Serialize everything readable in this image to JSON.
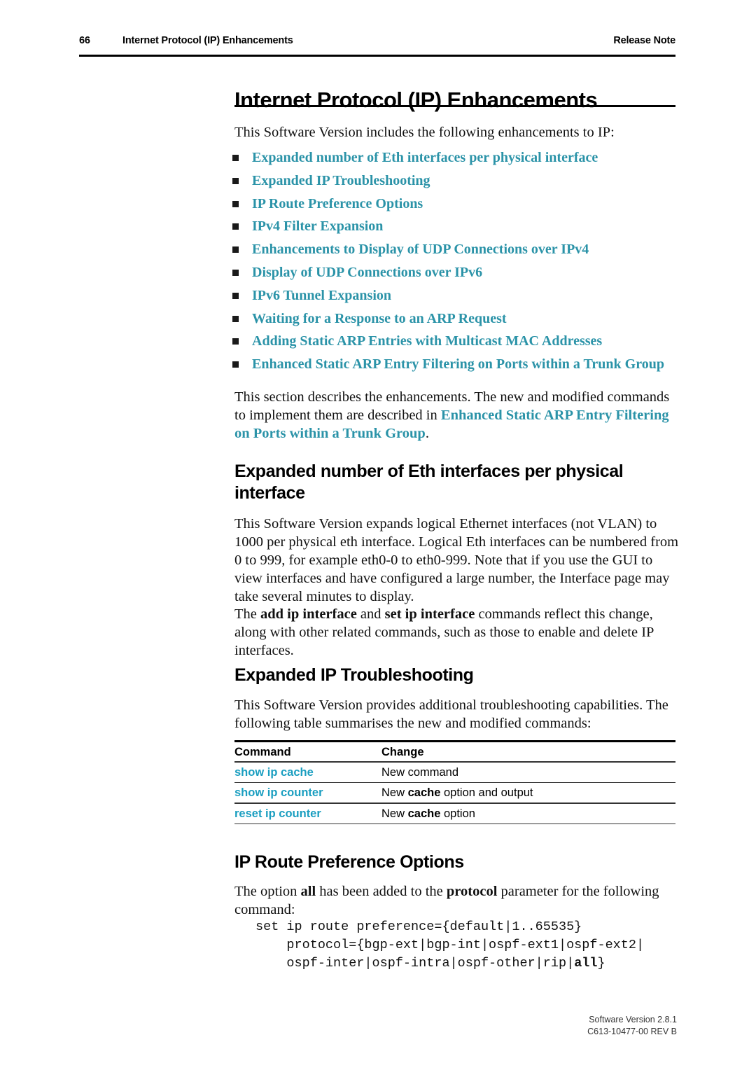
{
  "header": {
    "page_number": "66",
    "section_title": "Internet Protocol (IP) Enhancements",
    "document_type": "Release Note"
  },
  "chapter": {
    "title": "Internet Protocol (IP) Enhancements"
  },
  "intro": {
    "lead": "This Software Version includes the following enhancements to IP:",
    "links": [
      "Expanded number of Eth interfaces per physical interface",
      "Expanded IP Troubleshooting",
      "IP Route Preference Options",
      "IPv4 Filter Expansion",
      "Enhancements to Display of UDP Connections over IPv4",
      "Display of UDP Connections over IPv6",
      "IPv6 Tunnel Expansion",
      "Waiting for a Response to an ARP Request",
      "Adding Static ARP Entries with Multicast MAC Addresses",
      "Enhanced Static ARP Entry Filtering on Ports within a Trunk Group"
    ],
    "closing_prefix": "This section describes the enhancements. The new and modified commands to implement them are described in ",
    "closing_link": "Enhanced Static ARP Entry Filtering on Ports within a Trunk Group",
    "closing_suffix": "."
  },
  "section_eth": {
    "heading": "Expanded number of Eth interfaces per physical interface",
    "para1": "This Software Version expands logical Ethernet interfaces (not VLAN) to 1000 per physical eth interface. Logical Eth interfaces can be numbered from 0 to 999, for example eth0-0 to eth0-999. Note that if you use the GUI to view interfaces and have configured a large number, the Interface page may take several minutes to display.",
    "para2_a": "The ",
    "para2_b1": "add ip interface",
    "para2_c": " and ",
    "para2_b2": "set ip interface",
    "para2_d": " commands reflect this change, along with other related commands, such as those to enable and delete IP interfaces."
  },
  "section_troubleshooting": {
    "heading": "Expanded IP Troubleshooting",
    "para": "This Software Version provides additional troubleshooting capabilities. The following table summarises the new and modified commands:",
    "table": {
      "columns": [
        "Command",
        "Change"
      ],
      "rows": [
        {
          "command": "show ip cache",
          "change_prefix": "New command",
          "change_bold": "",
          "change_suffix": ""
        },
        {
          "command": "show ip counter",
          "change_prefix": "New ",
          "change_bold": "cache",
          "change_suffix": " option and output"
        },
        {
          "command": "reset ip counter",
          "change_prefix": "New ",
          "change_bold": "cache",
          "change_suffix": " option"
        }
      ]
    }
  },
  "section_route_pref": {
    "heading": "IP Route Preference Options",
    "para_a": "The option ",
    "para_b1": "all",
    "para_c": " has been added to the ",
    "para_b2": "protocol",
    "para_d": " parameter for the following command:",
    "code_line1": "set ip route preference={default|1..65535}",
    "code_line2": "    protocol={bgp-ext|bgp-int|ospf-ext1|ospf-ext2|",
    "code_line3": "    ospf-inter|ospf-intra|ospf-other|rip|",
    "code_bold": "all",
    "code_tail": "}"
  },
  "footer": {
    "software_version": "Software Version 2.8.1",
    "document_code": "C613-10477-00 REV B"
  },
  "colors": {
    "link_teal": "#2B93A8",
    "table_link_teal": "#1A9EC0",
    "rule_black": "#000000"
  }
}
